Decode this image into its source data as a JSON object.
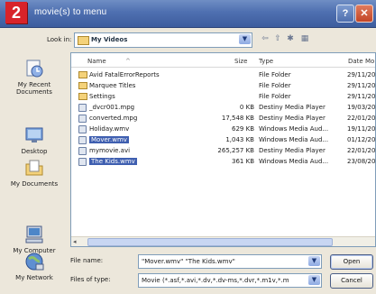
{
  "window": {
    "step_number": "2",
    "title": "movie(s) to menu",
    "help_label": "?",
    "close_label": "✕"
  },
  "lookin": {
    "label": "Look in:",
    "value": "My Videos"
  },
  "places": [
    {
      "label": "My Recent Documents",
      "icon": "recent-documents-icon"
    },
    {
      "label": "Desktop",
      "icon": "desktop-icon"
    },
    {
      "label": "My Documents",
      "icon": "my-documents-icon"
    },
    {
      "label": "My Computer",
      "icon": "my-computer-icon"
    },
    {
      "label": "My Network",
      "icon": "my-network-icon"
    }
  ],
  "columns": {
    "name": "Name",
    "size": "Size",
    "type": "Type",
    "date": "Date Mo"
  },
  "files": [
    {
      "name": "Avid FatalErrorReports",
      "size": "",
      "type": "File Folder",
      "date": "29/11/20",
      "kind": "folder",
      "selected": false
    },
    {
      "name": "Marquee Titles",
      "size": "",
      "type": "File Folder",
      "date": "29/11/20",
      "kind": "folder",
      "selected": false
    },
    {
      "name": "Settings",
      "size": "",
      "type": "File Folder",
      "date": "29/11/20",
      "kind": "folder",
      "selected": false
    },
    {
      "name": "_dvcr001.mpg",
      "size": "0 KB",
      "type": "Destiny Media Player",
      "date": "19/03/20",
      "kind": "media",
      "selected": false
    },
    {
      "name": "converted.mpg",
      "size": "17,548 KB",
      "type": "Destiny Media Player",
      "date": "22/01/20",
      "kind": "media",
      "selected": false
    },
    {
      "name": "Holiday.wmv",
      "size": "629 KB",
      "type": "Windows Media Aud...",
      "date": "19/11/20",
      "kind": "media",
      "selected": false
    },
    {
      "name": "Mover.wmv",
      "size": "1,043 KB",
      "type": "Windows Media Aud...",
      "date": "01/12/20",
      "kind": "media",
      "selected": true
    },
    {
      "name": "mymovie.avi",
      "size": "265,257 KB",
      "type": "Destiny Media Player",
      "date": "22/01/20",
      "kind": "media",
      "selected": false
    },
    {
      "name": "The Kids.wmv",
      "size": "361 KB",
      "type": "Windows Media Aud...",
      "date": "23/08/20",
      "kind": "media",
      "selected": true
    }
  ],
  "filename": {
    "label": "File name:",
    "value": "\"Mover.wmv\" \"The Kids.wmv\""
  },
  "filetype": {
    "label": "Files of type:",
    "value": "Movie (*.asf,*.avi,*.dv,*.dv-ms,*.dvr,*.m1v,*.m"
  },
  "buttons": {
    "open": "Open",
    "cancel": "Cancel"
  }
}
